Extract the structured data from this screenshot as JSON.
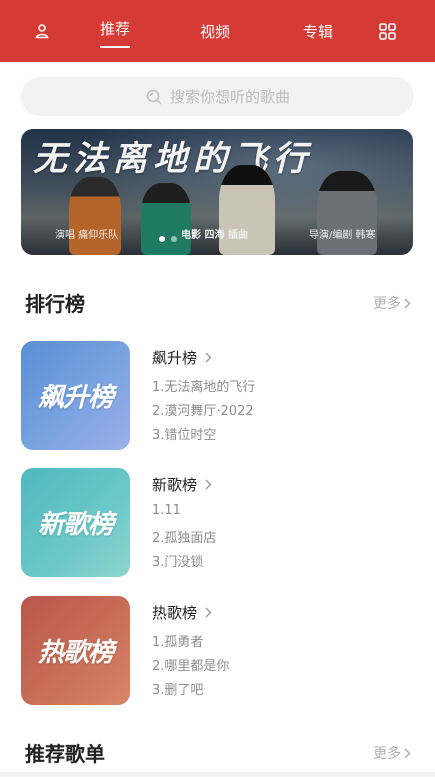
{
  "nav": {
    "user_icon": "user-icon",
    "tabs": [
      {
        "label": "推荐"
      },
      {
        "label": "视频"
      },
      {
        "label": "专辑"
      }
    ],
    "grid_icon": "grid-icon",
    "active_tab": "推荐",
    "color": "#d63a35"
  },
  "search": {
    "placeholder": "搜索你想听的歌曲",
    "icon": "search-icon"
  },
  "banner": {
    "title": "无法离地的飞行",
    "caption_left": "演唱 痛仰乐队",
    "caption_mid": "电影 四海 插曲",
    "caption_right": "导演/编剧 韩寒",
    "dots": 2,
    "active_dot": 1
  },
  "charts_section": {
    "title": "排行榜",
    "more": "更多"
  },
  "rankings": [
    {
      "cover_text": "飙升榜",
      "name": "飙升榜",
      "songs": [
        "1.无法离地的飞行",
        "2.漠河舞厅·2022",
        "3.错位时空"
      ]
    },
    {
      "cover_text": "新歌榜",
      "name": "新歌榜",
      "songs": [
        "1.11",
        "2.孤独面店",
        "3.门没锁"
      ]
    },
    {
      "cover_text": "热歌榜",
      "name": "热歌榜",
      "songs": [
        "1.孤勇者",
        "2.哪里都是你",
        "3.删了吧"
      ]
    }
  ],
  "playlist_section": {
    "title": "推荐歌单",
    "more": "更多"
  }
}
